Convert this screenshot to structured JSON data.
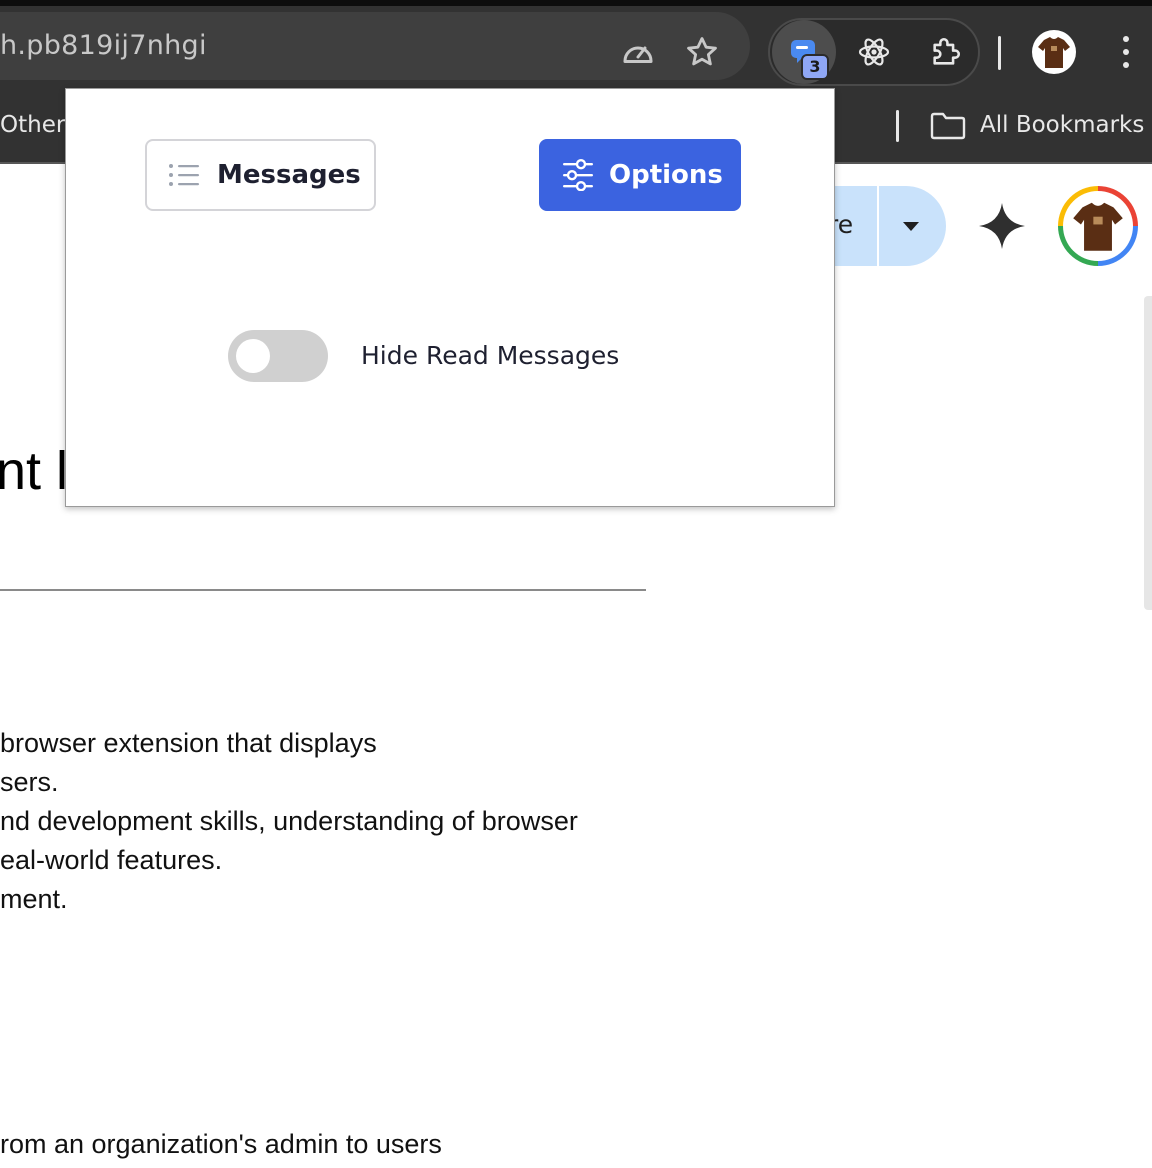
{
  "toolbar": {
    "url_text": "h.pb819ij7nhgi",
    "extension_badge_count": "3"
  },
  "bookmarks": {
    "others_label": "Others",
    "all_bookmarks_label": "All Bookmarks"
  },
  "page": {
    "share_partial": "re",
    "heading_partial": "nt l",
    "lines": [
      " browser extension that displays",
      "sers.",
      "nd development skills, understanding of browser",
      "eal-world features.",
      "ment.",
      "rom an organization's admin to users"
    ]
  },
  "popup": {
    "messages_tab_label": "Messages",
    "options_tab_label": "Options",
    "active_tab": "Options",
    "hide_read_label": "Hide Read Messages",
    "hide_read_enabled": false,
    "accent_color": "#3b63e0"
  },
  "icons": [
    "speedometer-icon",
    "star-icon",
    "chat-extension-icon",
    "react-icon",
    "puzzle-icon",
    "kebab-menu-icon",
    "folder-icon",
    "sparkle-icon",
    "list-icon",
    "sliders-icon"
  ]
}
